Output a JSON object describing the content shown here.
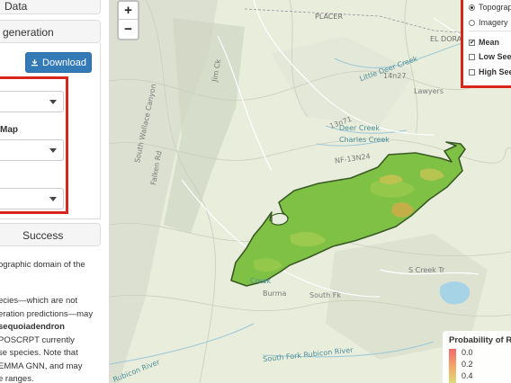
{
  "sidebar": {
    "panel1_title": "Data",
    "panel2_title": "generation",
    "download_label": "Download",
    "map_label": "Map",
    "panel3_title": "Success",
    "text1": [
      "ographic domain of the",
      "."
    ],
    "text2": [
      "ecies—which are not",
      "eration predictions—may",
      "sequoiadendron",
      "POSCRPT currently",
      "se species. Note that",
      "EMMA GNN, and may",
      "e ranges."
    ]
  },
  "map": {
    "zoom_in": "+",
    "zoom_out": "−",
    "layers": {
      "topographic": "Topographic",
      "imagery": "Imagery",
      "mean": "Mean",
      "low_seed": "Low Seed",
      "high_seed": "High Seed"
    },
    "legend": {
      "title": "Probability of R",
      "ticks": [
        "0.0",
        "0.2",
        "0.4"
      ]
    },
    "labels": {
      "placer": "PLACER",
      "el_dorado": "EL DORA",
      "little_deer_creek": "Little Deer Creek",
      "deer_creek": "Deer Creek",
      "charles_creek": "Charles Creek",
      "south_wallace_canyon": "South Wallace Canyon",
      "rubicon_river": "Rubicon River",
      "south_fork_rubicon_river": "South Fork Rubicon River",
      "nf_13n24": "NF-13N24",
      "s_creek_tr": "S Creek Tr",
      "creek": "Creek",
      "burma": "Burma",
      "south_fk": "South Fk",
      "lawyers": "Lawyers",
      "road_14n27": "14n27",
      "road_13n71": "13n71",
      "falken": "Falken Rd",
      "jim_ck": "Jim Ck"
    }
  },
  "colors": {
    "accent": "#337ab7",
    "highlight_border": "#d9261c",
    "region_fill": "#79c043"
  }
}
